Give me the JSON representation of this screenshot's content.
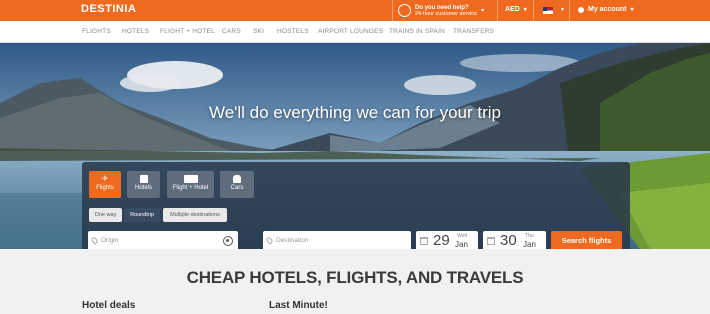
{
  "header": {
    "logo": "DESTINIA",
    "help_title": "Do you need help?",
    "help_sub": "24-hour customer service",
    "currency": "AED",
    "account": "My account"
  },
  "nav": [
    "FLIGHTS",
    "HOTELS",
    "FLIGHT + HOTEL",
    "CARS",
    "SKI",
    "HOSTELS",
    "AIRPORT LOUNGES",
    "TRAINS IN SPAIN",
    "TRANSFERS"
  ],
  "hero": {
    "headline": "We'll do everything we can for your trip"
  },
  "search": {
    "tabs": [
      "Flights",
      "Hotels",
      "Flight + Hotel",
      "Cars"
    ],
    "active_tab": "Flights",
    "trip_types": [
      "One way",
      "Roundtrip",
      "Multiple destinations"
    ],
    "active_trip": "Roundtrip",
    "origin_placeholder": "Origin",
    "destination_placeholder": "Destination",
    "depart": {
      "day": "29",
      "weekday": "Wed",
      "month": "Jan"
    },
    "return": {
      "day": "30",
      "weekday": "Thu",
      "month": "Jan"
    },
    "button": "Search flights"
  },
  "content": {
    "title": "CHEAP HOTELS, FLIGHTS, AND TRAVELS",
    "hotel_deals": "Hotel deals",
    "last_minute": "Last Minute!"
  },
  "colors": {
    "brand": "#ef6a1f",
    "panel": "#28374b"
  }
}
